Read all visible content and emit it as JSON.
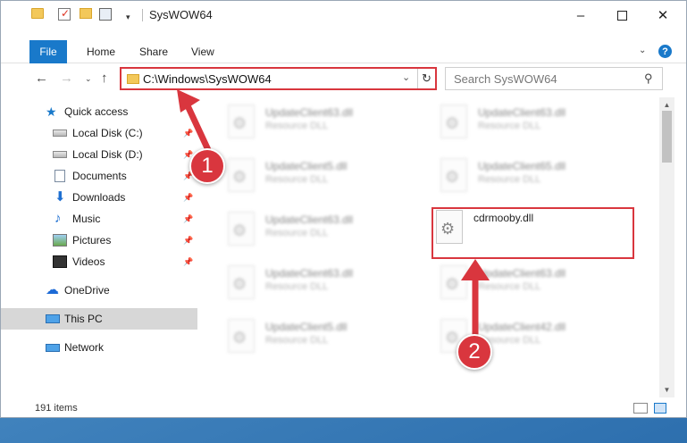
{
  "window": {
    "title": "SysWOW64",
    "minimize_label": "–",
    "maximize_label": "",
    "close_label": "✕",
    "dropdown_glyph": "▾"
  },
  "ribbon": {
    "tabs": [
      "File",
      "Home",
      "Share",
      "View"
    ],
    "expand_glyph": "⌄",
    "help_glyph": "?"
  },
  "nav": {
    "back": "←",
    "forward": "→",
    "recent": "⌄",
    "up": "↑",
    "address": "C:\\Windows\\SysWOW64",
    "address_dropdown": "⌄",
    "refresh": "↻",
    "search_placeholder": "Search SysWOW64",
    "search_glyph": "⚲"
  },
  "sidebar": {
    "items": [
      {
        "label": "Quick access",
        "icon": "star-icon",
        "pinned": false
      },
      {
        "label": "Local Disk (C:)",
        "icon": "disk-icon",
        "pinned": true
      },
      {
        "label": "Local Disk (D:)",
        "icon": "disk-icon",
        "pinned": true
      },
      {
        "label": "Documents",
        "icon": "documents-icon",
        "pinned": true
      },
      {
        "label": "Downloads",
        "icon": "download-icon",
        "pinned": true
      },
      {
        "label": "Music",
        "icon": "music-icon",
        "pinned": true
      },
      {
        "label": "Pictures",
        "icon": "pictures-icon",
        "pinned": true
      },
      {
        "label": "Videos",
        "icon": "videos-icon",
        "pinned": true
      },
      {
        "label": "OneDrive",
        "icon": "cloud-icon",
        "pinned": false
      },
      {
        "label": "This PC",
        "icon": "computer-icon",
        "pinned": false,
        "selected": true
      },
      {
        "label": "Network",
        "icon": "network-icon",
        "pinned": false
      }
    ],
    "pin_glyph": "📌"
  },
  "files": {
    "col1": [
      {
        "name": "UpdateClient63.dll",
        "type": "Resource DLL"
      },
      {
        "name": "UpdateClient5.dll",
        "type": "Resource DLL"
      },
      {
        "name": "UpdateClient63.dll",
        "type": "Resource DLL"
      },
      {
        "name": "UpdateClient63.dll",
        "type": "Resource DLL"
      },
      {
        "name": "UpdateClient5.dll",
        "type": "Resource DLL"
      }
    ],
    "col2": [
      {
        "name": "UpdateClient63.dll",
        "type": "Resource DLL"
      },
      {
        "name": "UpdateClient65.dll",
        "type": "Resource DLL"
      },
      {
        "name": "cdrmooby.dll",
        "type": "",
        "highlighted": true
      },
      {
        "name": "UpdateClient63.dll",
        "type": "Resource DLL"
      },
      {
        "name": "UpdateClient42.dll",
        "type": "Resource DLL"
      }
    ]
  },
  "status": {
    "item_count": "191 items"
  },
  "callouts": {
    "step1": "1",
    "step2": "2",
    "accent_color": "#d9363e"
  },
  "colors": {
    "file_tab": "#1979ca",
    "highlight": "#d9363e",
    "selection": "#d7d7d7"
  }
}
